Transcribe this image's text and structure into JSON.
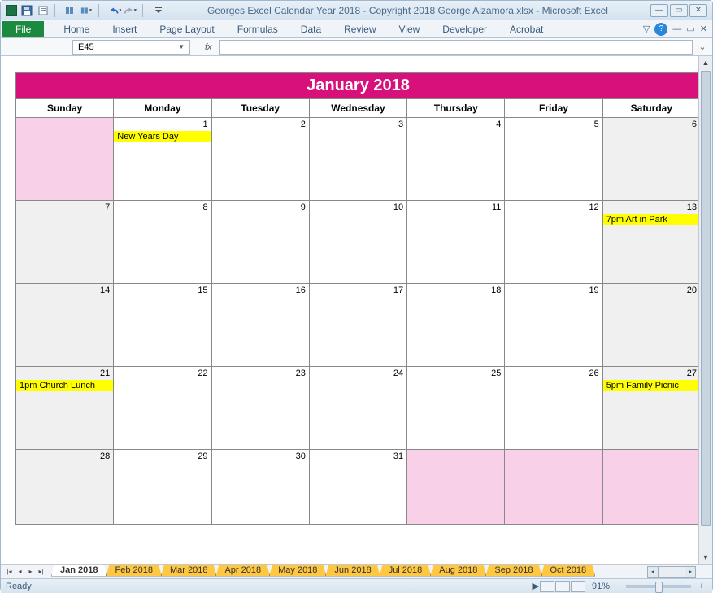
{
  "window": {
    "title": "Georges Excel Calendar Year 2018  -  Copyright 2018 George Alzamora.xlsx  -  Microsoft Excel"
  },
  "ribbon": {
    "file": "File",
    "tabs": [
      "Home",
      "Insert",
      "Page Layout",
      "Formulas",
      "Data",
      "Review",
      "View",
      "Developer",
      "Acrobat"
    ]
  },
  "formula_bar": {
    "name_box": "E45",
    "fx": "fx",
    "value": ""
  },
  "calendar": {
    "title": "January 2018",
    "day_headers": [
      "Sunday",
      "Monday",
      "Tuesday",
      "Wednesday",
      "Thursday",
      "Friday",
      "Saturday"
    ],
    "weeks": [
      [
        {
          "d": "",
          "bg": "pink"
        },
        {
          "d": "1",
          "bg": "white",
          "event": "New Years Day"
        },
        {
          "d": "2",
          "bg": "white"
        },
        {
          "d": "3",
          "bg": "white"
        },
        {
          "d": "4",
          "bg": "white"
        },
        {
          "d": "5",
          "bg": "white"
        },
        {
          "d": "6",
          "bg": "grey"
        }
      ],
      [
        {
          "d": "7",
          "bg": "grey"
        },
        {
          "d": "8",
          "bg": "white"
        },
        {
          "d": "9",
          "bg": "white"
        },
        {
          "d": "10",
          "bg": "white"
        },
        {
          "d": "11",
          "bg": "white"
        },
        {
          "d": "12",
          "bg": "white"
        },
        {
          "d": "13",
          "bg": "grey",
          "event": "7pm Art in Park"
        }
      ],
      [
        {
          "d": "14",
          "bg": "grey"
        },
        {
          "d": "15",
          "bg": "white"
        },
        {
          "d": "16",
          "bg": "white"
        },
        {
          "d": "17",
          "bg": "white"
        },
        {
          "d": "18",
          "bg": "white"
        },
        {
          "d": "19",
          "bg": "white"
        },
        {
          "d": "20",
          "bg": "grey"
        }
      ],
      [
        {
          "d": "21",
          "bg": "grey",
          "event": "1pm Church Lunch"
        },
        {
          "d": "22",
          "bg": "white"
        },
        {
          "d": "23",
          "bg": "white"
        },
        {
          "d": "24",
          "bg": "white"
        },
        {
          "d": "25",
          "bg": "white"
        },
        {
          "d": "26",
          "bg": "white"
        },
        {
          "d": "27",
          "bg": "grey",
          "event": "5pm Family Picnic"
        }
      ],
      [
        {
          "d": "28",
          "bg": "grey"
        },
        {
          "d": "29",
          "bg": "white"
        },
        {
          "d": "30",
          "bg": "white"
        },
        {
          "d": "31",
          "bg": "white"
        },
        {
          "d": "",
          "bg": "pink"
        },
        {
          "d": "",
          "bg": "pink"
        },
        {
          "d": "",
          "bg": "pink"
        }
      ]
    ]
  },
  "sheet_tabs": {
    "active": "Jan 2018",
    "tabs": [
      "Jan 2018",
      "Feb 2018",
      "Mar 2018",
      "Apr 2018",
      "May 2018",
      "Jun 2018",
      "Jul 2018",
      "Aug 2018",
      "Sep 2018",
      "Oct 2018"
    ]
  },
  "status": {
    "ready": "Ready",
    "zoom": "91%"
  }
}
